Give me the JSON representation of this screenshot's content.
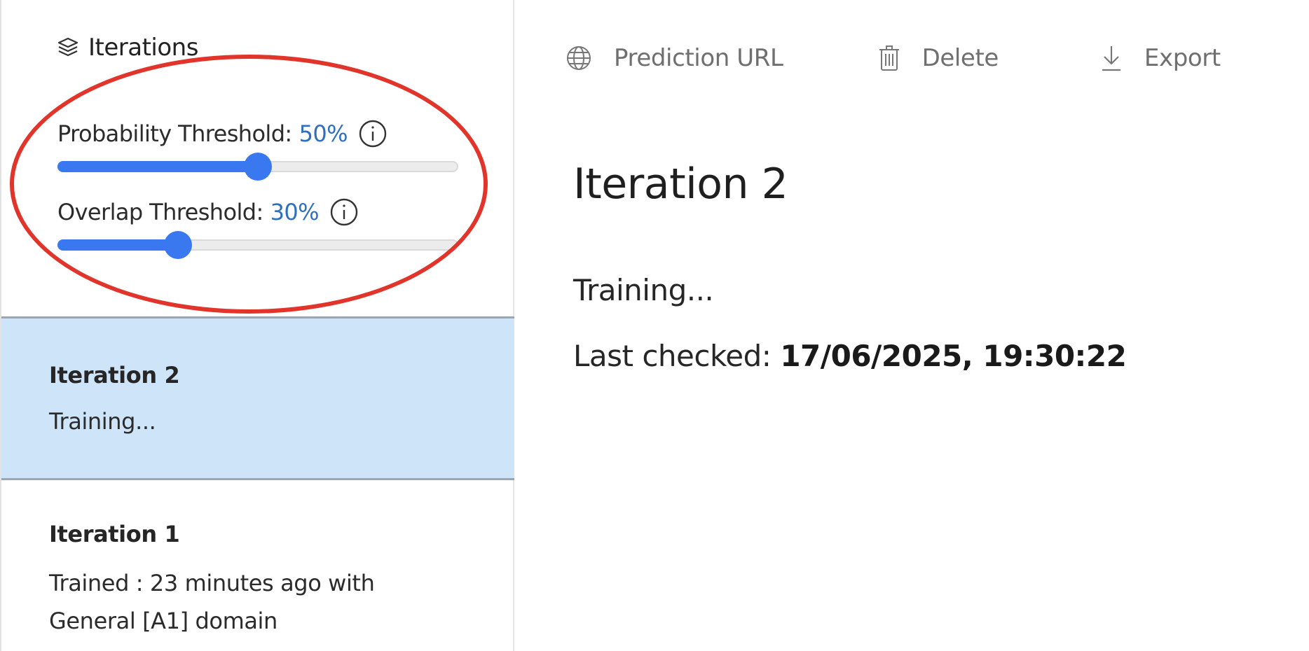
{
  "sidebar": {
    "title": "Iterations",
    "header_icon": "layers-icon",
    "probability_threshold": {
      "label": "Probability Threshold:",
      "value_text": "50%",
      "value": 50,
      "info_icon": "info-icon"
    },
    "overlap_threshold": {
      "label": "Overlap Threshold:",
      "value_text": "30%",
      "value": 30,
      "info_icon": "info-icon"
    },
    "iterations": [
      {
        "name": "Iteration 2",
        "status": "Training...",
        "selected": true
      },
      {
        "name": "Iteration 1",
        "status": "Trained : 23 minutes ago with General [A1] domain",
        "selected": false
      }
    ]
  },
  "toolbar": {
    "prediction_url": {
      "label": "Prediction URL",
      "icon": "globe-icon"
    },
    "delete": {
      "label": "Delete",
      "icon": "trash-icon"
    },
    "export": {
      "label": "Export",
      "icon": "download-icon"
    }
  },
  "detail": {
    "title": "Iteration 2",
    "status": "Training...",
    "last_checked_label": "Last checked: ",
    "last_checked_value": "17/06/2025, 19:30:22"
  },
  "colors": {
    "accent": "#3a78f0",
    "value_text": "#2f6fc0",
    "selected_bg": "#cde4f9",
    "annotation": "#e1342b"
  }
}
